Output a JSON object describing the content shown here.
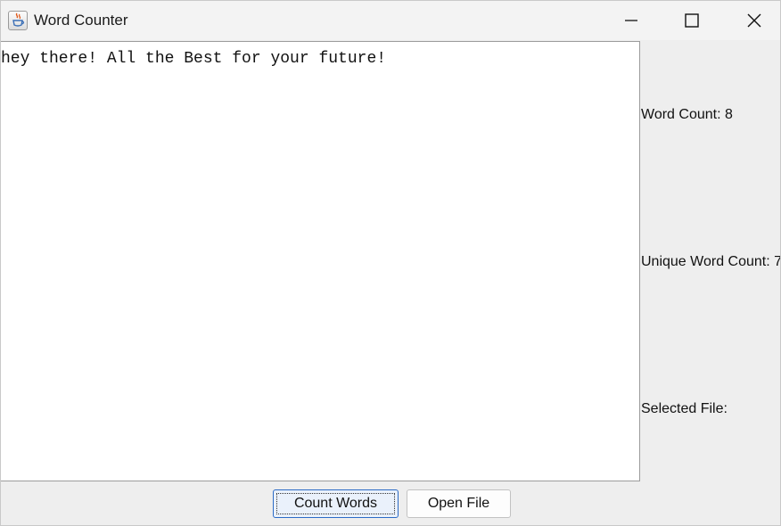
{
  "window": {
    "title": "Word Counter",
    "app_icon": "java-cup-icon",
    "controls": [
      "minimize-icon",
      "maximize-icon",
      "close-icon"
    ]
  },
  "editor": {
    "text": "hey there! All the Best for your future!"
  },
  "stats": {
    "word_count_label": "Word Count: 8",
    "unique_word_count_label": "Unique Word Count: 7",
    "selected_file_label": "Selected File:"
  },
  "buttons": {
    "count_words_label": "Count Words",
    "open_file_label": "Open File"
  }
}
